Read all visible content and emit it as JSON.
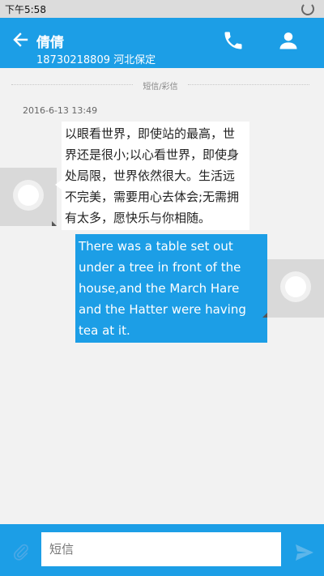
{
  "status_bar": {
    "time": "下午5:58"
  },
  "header": {
    "title": "倩倩",
    "subtitle": "18730218809 河北保定",
    "colors": {
      "accent": "#1c9ee6"
    }
  },
  "divider": {
    "label": "短信/彩信"
  },
  "conversation": {
    "timestamp": "2016-6-13 13:49",
    "messages": [
      {
        "direction": "incoming",
        "text": "以眼看世界，即使站的最高，世界还是很小;以心看世界，即使身处局限，世界依然很大。生活远不完美，需要用心去体会;无需拥有太多，愿快乐与你相随。"
      },
      {
        "direction": "outgoing",
        "text": "There was a table set out under a tree in front of the house,and the March Hare and the Hatter were having tea at it."
      }
    ]
  },
  "composer": {
    "placeholder": "短信"
  }
}
